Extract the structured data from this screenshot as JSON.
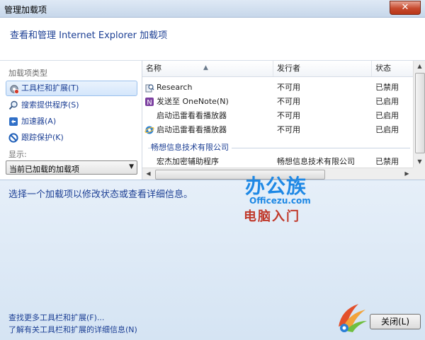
{
  "window": {
    "title": "管理加载项",
    "close_glyph": "✕"
  },
  "header": {
    "text": "查看和管理 Internet Explorer 加载项"
  },
  "sidebar": {
    "type_label": "加载项类型",
    "items": [
      {
        "label": "工具栏和扩展(T)",
        "icon": "gear-icon"
      },
      {
        "label": "搜索提供程序(S)",
        "icon": "search-icon"
      },
      {
        "label": "加速器(A)",
        "icon": "accelerator-icon"
      },
      {
        "label": "跟踪保护(K)",
        "icon": "block-icon"
      }
    ],
    "show_label": "显示:",
    "show_value": "当前已加载的加载项"
  },
  "list": {
    "columns": [
      "名称",
      "发行者",
      "状态"
    ],
    "rows": [
      {
        "name": "Research",
        "publisher": "不可用",
        "status": "已禁用",
        "icon": "research-icon"
      },
      {
        "name": "发送至 OneNote(N)",
        "publisher": "不可用",
        "status": "已启用",
        "icon": "onenote-icon"
      },
      {
        "name": "启动迅雷看看播放器",
        "publisher": "不可用",
        "status": "已启用",
        "icon": ""
      },
      {
        "name": "启动迅雷看看播放器",
        "publisher": "不可用",
        "status": "已启用",
        "icon": "ie-icon"
      }
    ],
    "group": "畅想信息技术有限公司",
    "group_rows": [
      {
        "name": "宏杰加密辅助程序",
        "publisher": "畅想信息技术有限公司",
        "status": "已禁用"
      }
    ]
  },
  "details": {
    "hint": "选择一个加载项以修改状态或查看详细信息。",
    "link1": "查找更多工具栏和扩展(F)...",
    "link2": "了解有关工具栏和扩展的详细信息(N)",
    "close_label": "关闭(L)"
  },
  "watermark": {
    "main": "办公族",
    "url": "Officezu.com",
    "sub": "电脑入门"
  }
}
